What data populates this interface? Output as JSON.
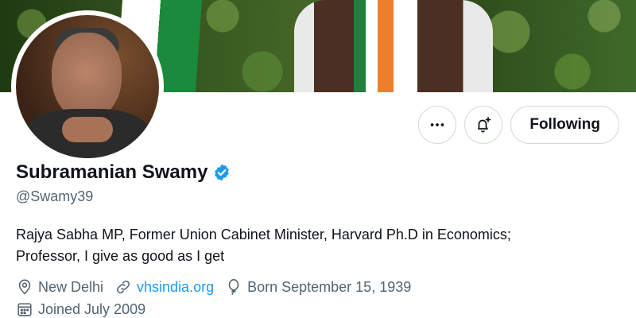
{
  "profile": {
    "name": "Subramanian Swamy",
    "handle": "@Swamy39",
    "bio_line1": "Rajya Sabha MP, Former Union Cabinet Minister, Harvard Ph.D in Economics;",
    "bio_line2": "Professor, I give as good as I get",
    "verified": true,
    "location": "New Delhi",
    "website": "vhsindia.org",
    "born": "Born September 15, 1939",
    "joined": "Joined July 2009"
  },
  "actions": {
    "more_icon": "more-horizontal-icon",
    "notify_icon": "bell-plus-icon",
    "following_label": "Following"
  },
  "icons": {
    "verified": "verified-badge-icon",
    "location": "location-pin-icon",
    "link": "link-icon",
    "birthday": "balloon-icon",
    "calendar": "calendar-icon"
  },
  "colors": {
    "accent": "#1d9bf0",
    "text": "#0f1419",
    "secondary": "#536471",
    "border": "#cfd9de"
  }
}
